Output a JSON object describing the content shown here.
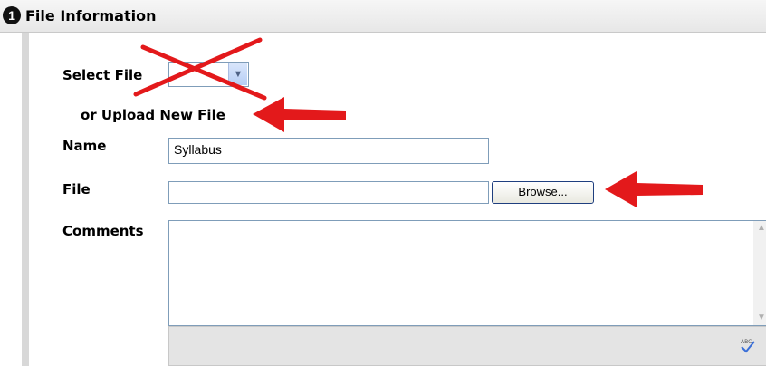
{
  "section": {
    "step_number": "1",
    "title": "File Information"
  },
  "form": {
    "select_file_label": "Select File",
    "upload_new_label": "or Upload New File",
    "name_label": "Name",
    "name_value": "Syllabus",
    "file_label": "File",
    "file_value": "",
    "browse_label": "Browse...",
    "comments_label": "Comments",
    "comments_value": "",
    "spellcheck_text": "ABC"
  },
  "annotations": {
    "arrow_color": "#e3191b",
    "cross_color": "#e3191b"
  }
}
